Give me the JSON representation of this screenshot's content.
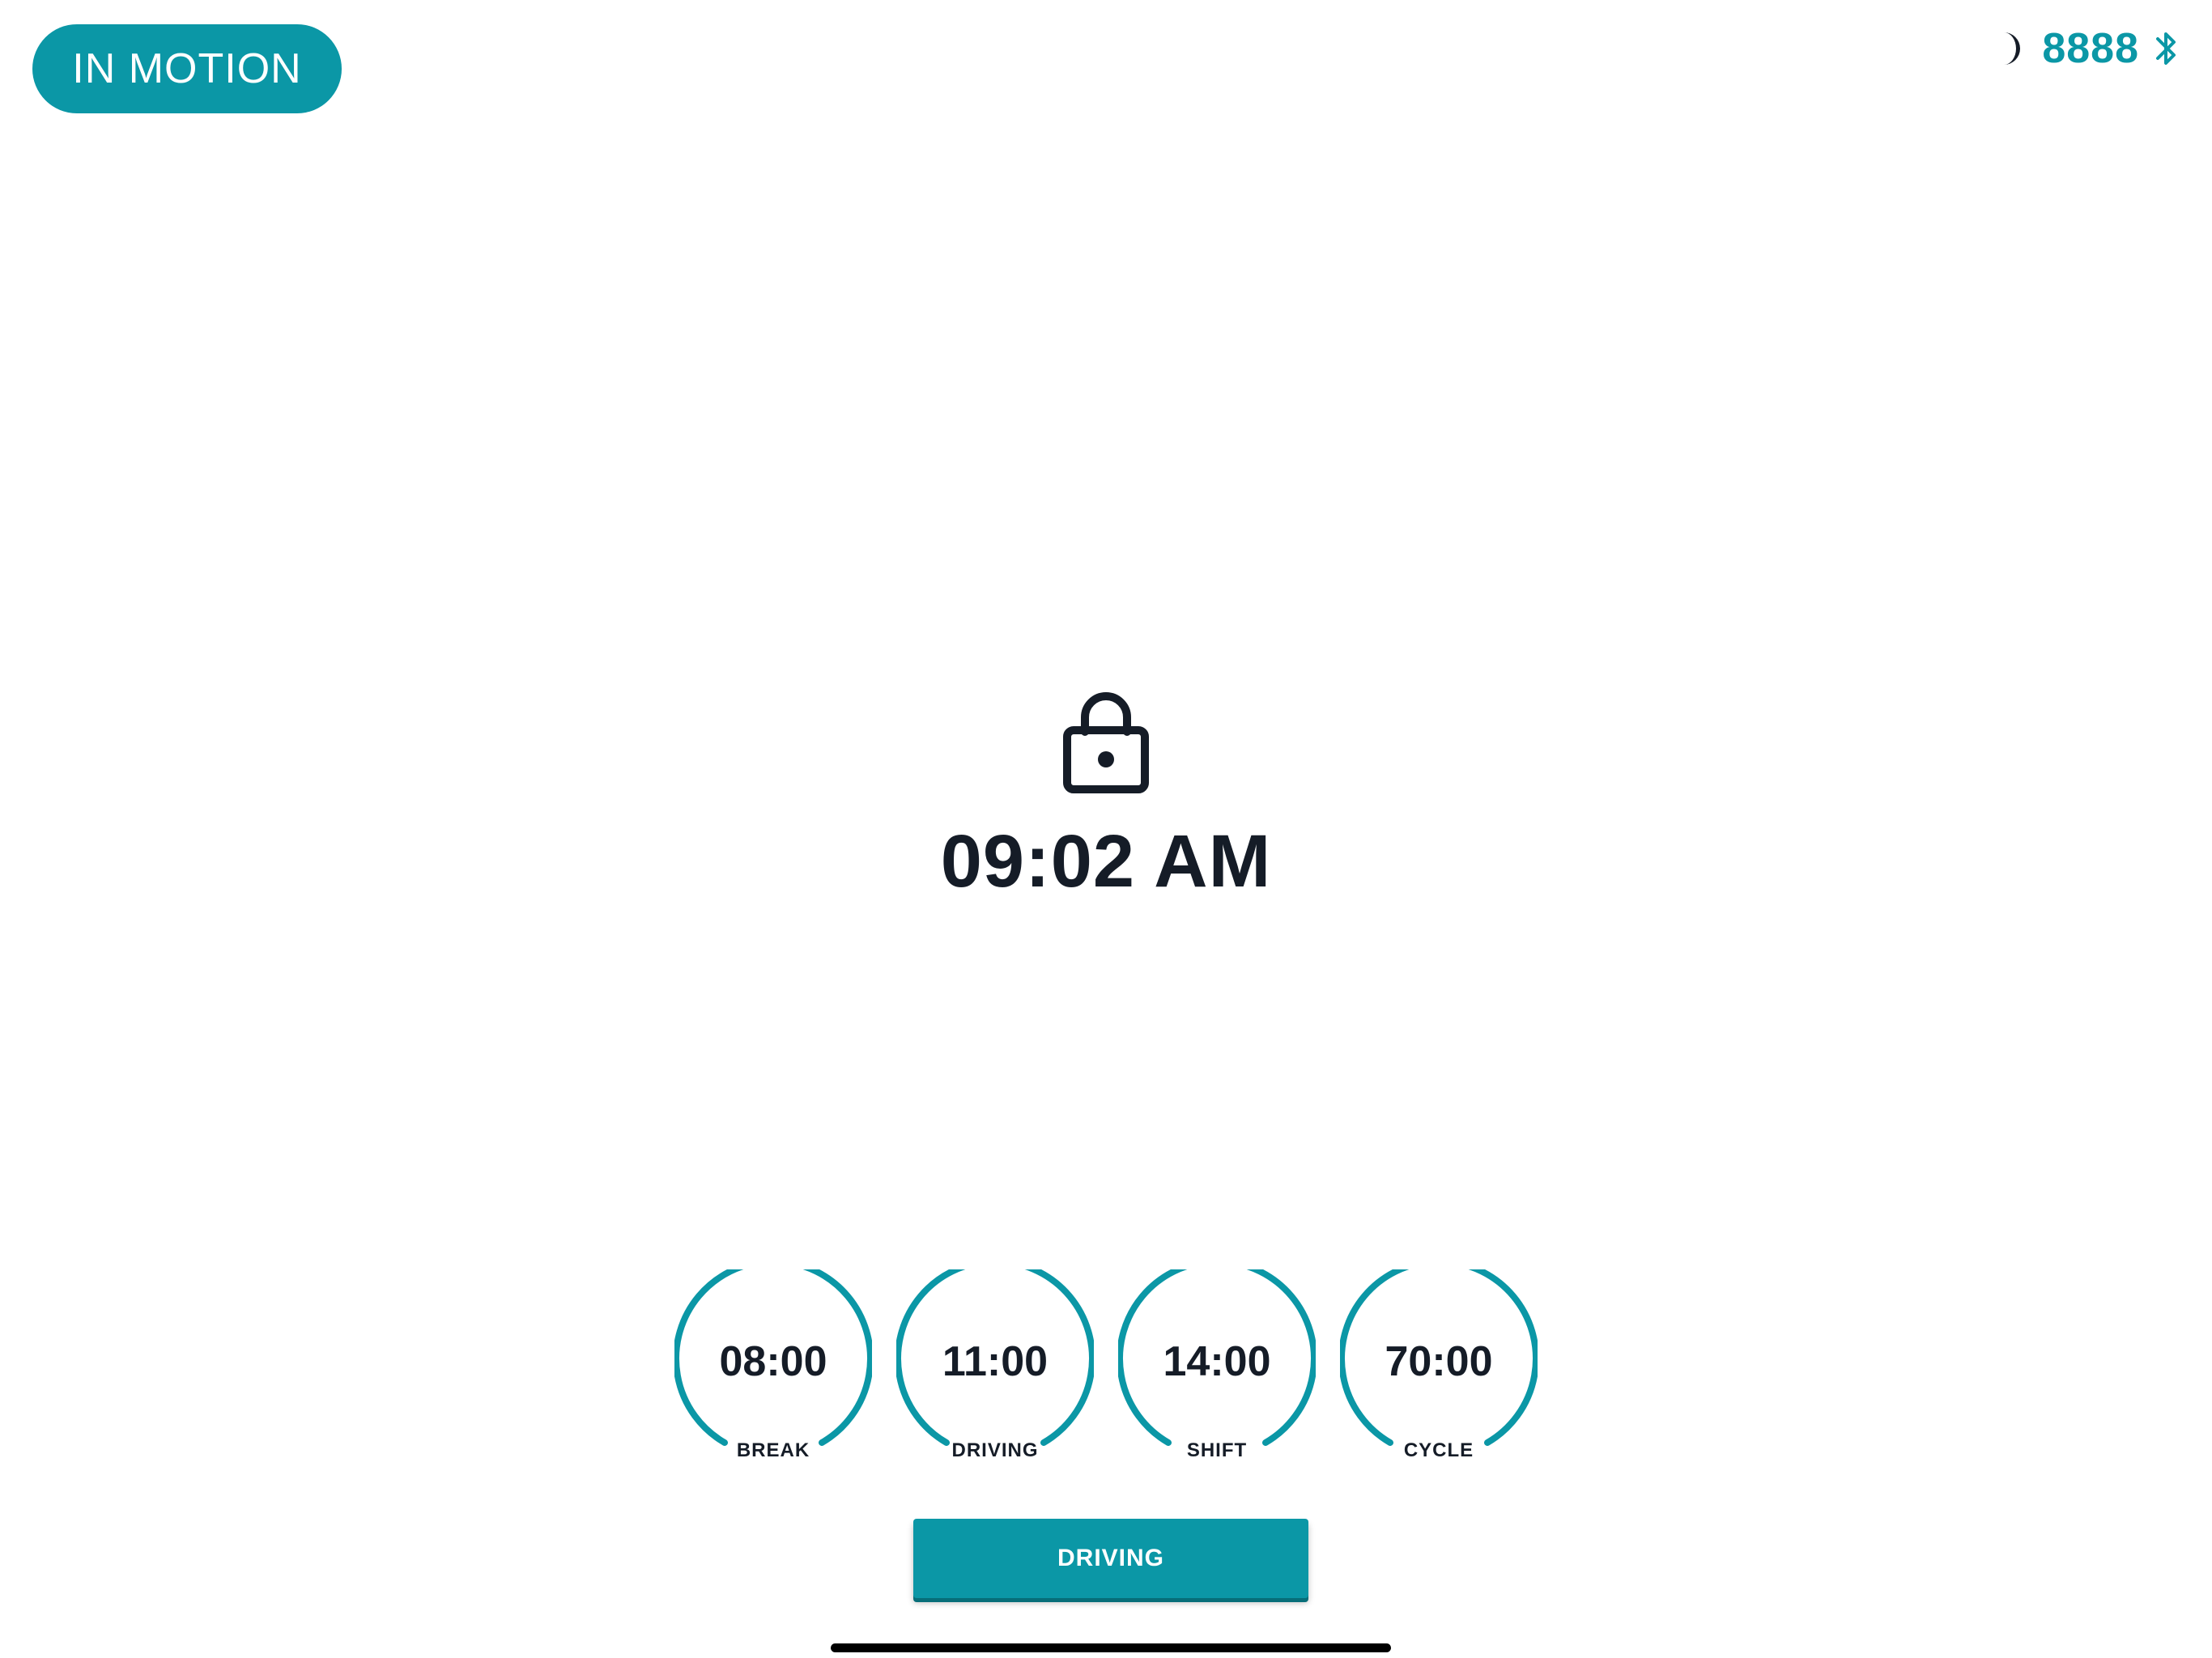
{
  "theme": {
    "accent": "#0b97a6",
    "text": "#151c27"
  },
  "status_pill": {
    "label": "IN MOTION"
  },
  "top_right": {
    "night_mode_icon": "moon-icon",
    "unit_number": "8888",
    "bluetooth_icon": "bluetooth-icon"
  },
  "lock_screen": {
    "icon": "lock-icon",
    "time": "09:02 AM"
  },
  "gauges": [
    {
      "value": "08:00",
      "label": "BREAK"
    },
    {
      "value": "11:00",
      "label": "DRIVING"
    },
    {
      "value": "14:00",
      "label": "SHIFT"
    },
    {
      "value": "70:00",
      "label": "CYCLE"
    }
  ],
  "duty_button": {
    "label": "DRIVING"
  }
}
